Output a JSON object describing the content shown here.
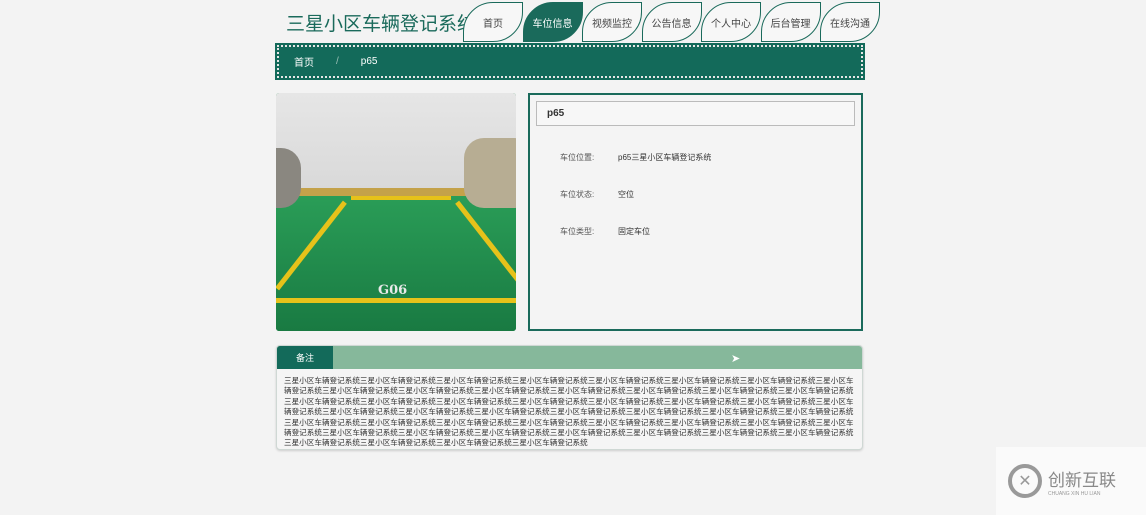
{
  "app_title": "三星小区车辆登记系统",
  "nav": [
    "首页",
    "车位信息",
    "视频监控",
    "公告信息",
    "个人中心",
    "后台管理",
    "在线沟通"
  ],
  "active_nav": 1,
  "breadcrumb": {
    "home": "首页",
    "sep": "/",
    "current": "p65"
  },
  "photo": {
    "spot_label": "G06"
  },
  "detail": {
    "name": "p65",
    "fields": [
      {
        "label": "车位位置:",
        "value": "p65三星小区车辆登记系统"
      },
      {
        "label": "车位状态:",
        "value": "空位"
      },
      {
        "label": "车位类型:",
        "value": "固定车位"
      }
    ]
  },
  "remark": {
    "tab": "备注",
    "text": "三星小区车辆登记系统三星小区车辆登记系统三星小区车辆登记系统三星小区车辆登记系统三星小区车辆登记系统三星小区车辆登记系统三星小区车辆登记系统三星小区车辆登记系统三星小区车辆登记系统三星小区车辆登记系统三星小区车辆登记系统三星小区车辆登记系统三星小区车辆登记系统三星小区车辆登记系统三星小区车辆登记系统三星小区车辆登记系统三星小区车辆登记系统三星小区车辆登记系统三星小区车辆登记系统三星小区车辆登记系统三星小区车辆登记系统三星小区车辆登记系统三星小区车辆登记系统三星小区车辆登记系统三星小区车辆登记系统三星小区车辆登记系统三星小区车辆登记系统三星小区车辆登记系统三星小区车辆登记系统三星小区车辆登记系统三星小区车辆登记系统三星小区车辆登记系统三星小区车辆登记系统三星小区车辆登记系统三星小区车辆登记系统三星小区车辆登记系统三星小区车辆登记系统三星小区车辆登记系统三星小区车辆登记系统三星小区车辆登记系统三星小区车辆登记系统三星小区车辆登记系统三星小区车辆登记系统三星小区车辆登记系统三星小区车辆登记系统三星小区车辆登记系统三星小区车辆登记系统三星小区车辆登记系统三星小区车辆登记系统"
  },
  "watermark": {
    "cn": "创新互联",
    "en": "CHUANG XIN HU LIAN"
  },
  "colors": {
    "primary": "#136a5a",
    "light": "#86b89b"
  }
}
